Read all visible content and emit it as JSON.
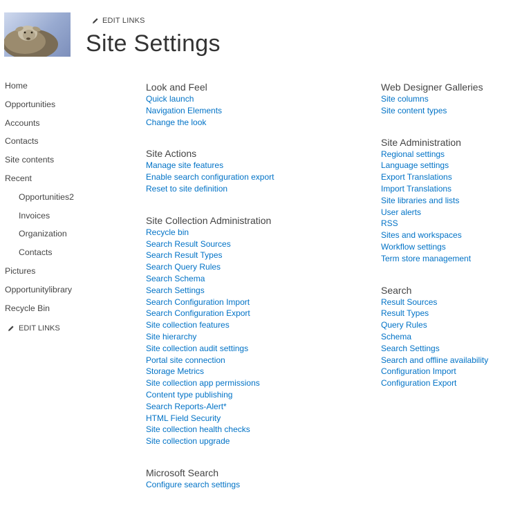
{
  "header": {
    "edit_links": "EDIT LINKS",
    "title": "Site Settings"
  },
  "left_nav": {
    "items": [
      "Home",
      "Opportunities",
      "Accounts",
      "Contacts",
      "Site contents",
      "Recent"
    ],
    "recent_items": [
      "Opportunities2",
      "Invoices",
      "Organization",
      "Contacts"
    ],
    "bottom_items": [
      "Pictures",
      "Opportunitylibrary",
      "Recycle Bin"
    ],
    "edit_links": "EDIT LINKS"
  },
  "sections_col1": [
    {
      "title": "Look and Feel",
      "links": [
        "Quick launch",
        "Navigation Elements",
        "Change the look"
      ]
    },
    {
      "title": "Site Actions",
      "links": [
        "Manage site features",
        "Enable search configuration export",
        "Reset to site definition"
      ]
    },
    {
      "title": "Site Collection Administration",
      "links": [
        "Recycle bin",
        "Search Result Sources",
        "Search Result Types",
        "Search Query Rules",
        "Search Schema",
        "Search Settings",
        "Search Configuration Import",
        "Search Configuration Export",
        "Site collection features",
        "Site hierarchy",
        "Site collection audit settings",
        "Portal site connection",
        "Storage Metrics",
        "Site collection app permissions",
        "Content type publishing",
        "Search Reports-Alert*",
        "HTML Field Security",
        "Site collection health checks",
        "Site collection upgrade"
      ]
    },
    {
      "title": "Microsoft Search",
      "links": [
        "Configure search settings"
      ]
    }
  ],
  "sections_col2": [
    {
      "title": "Web Designer Galleries",
      "links": [
        "Site columns",
        "Site content types"
      ]
    },
    {
      "title": "Site Administration",
      "links": [
        "Regional settings",
        "Language settings",
        "Export Translations",
        "Import Translations",
        "Site libraries and lists",
        "User alerts",
        "RSS",
        "Sites and workspaces",
        "Workflow settings",
        "Term store management"
      ]
    },
    {
      "title": "Search",
      "links": [
        "Result Sources",
        "Result Types",
        "Query Rules",
        "Schema",
        "Search Settings",
        "Search and offline availability",
        "Configuration Import",
        "Configuration Export"
      ]
    }
  ],
  "colors": {
    "link": "#0072c6",
    "text": "#444444",
    "title": "#333333"
  }
}
